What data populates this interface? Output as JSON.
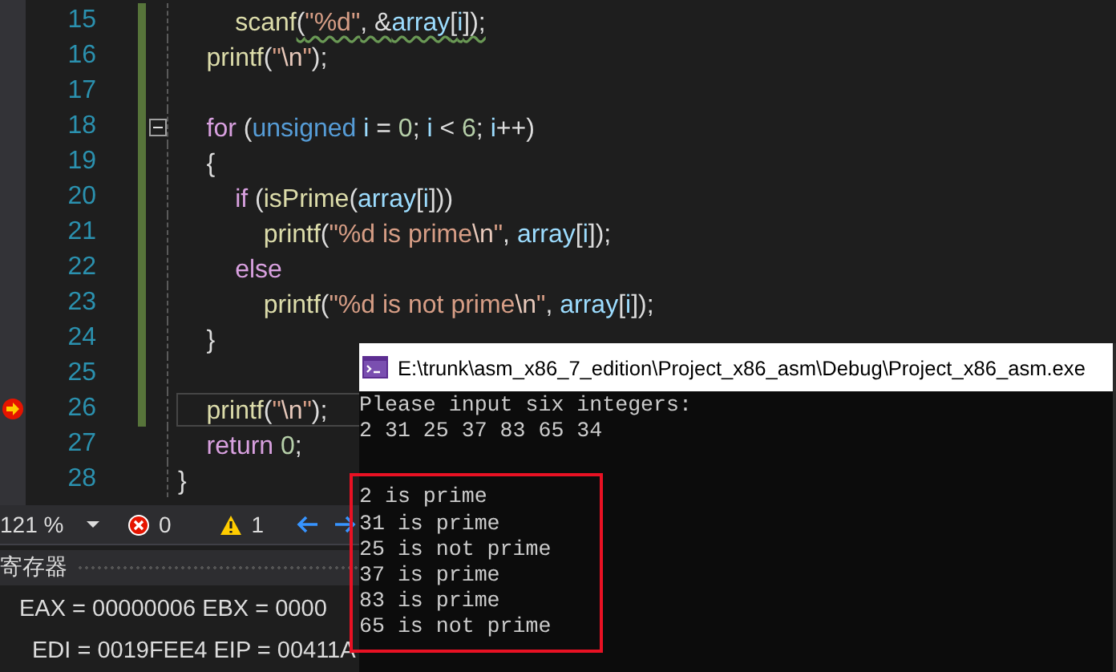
{
  "editor": {
    "lines": [
      {
        "number": "15",
        "changed": true,
        "current": false,
        "foldable": false,
        "warning": true,
        "tokens": [
          {
            "text": "        scanf",
            "kind": "func"
          },
          {
            "text": "(",
            "kind": "plain"
          },
          {
            "text": "\"%d\"",
            "kind": "string"
          },
          {
            "text": ", &",
            "kind": "plain"
          },
          {
            "text": "array",
            "kind": "var"
          },
          {
            "text": "[",
            "kind": "plain"
          },
          {
            "text": "i",
            "kind": "var"
          },
          {
            "text": "]);",
            "kind": "plain"
          }
        ]
      },
      {
        "number": "16",
        "changed": true,
        "current": false,
        "foldable": false,
        "warning": false,
        "tokens": [
          {
            "text": "    printf",
            "kind": "func"
          },
          {
            "text": "(",
            "kind": "plain"
          },
          {
            "text": "\"",
            "kind": "string"
          },
          {
            "text": "\\n",
            "kind": "escape"
          },
          {
            "text": "\"",
            "kind": "string"
          },
          {
            "text": ");",
            "kind": "plain"
          }
        ]
      },
      {
        "number": "17",
        "changed": true,
        "current": false,
        "foldable": false,
        "warning": false
      },
      {
        "number": "18",
        "changed": true,
        "current": false,
        "foldable": true,
        "warning": false,
        "tokens": [
          {
            "text": "    for",
            "kind": "control"
          },
          {
            "text": " (",
            "kind": "plain"
          },
          {
            "text": "unsigned",
            "kind": "keyword"
          },
          {
            "text": " i",
            "kind": "var"
          },
          {
            "text": " = ",
            "kind": "plain"
          },
          {
            "text": "0",
            "kind": "number"
          },
          {
            "text": "; ",
            "kind": "plain"
          },
          {
            "text": "i",
            "kind": "var"
          },
          {
            "text": " < ",
            "kind": "plain"
          },
          {
            "text": "6",
            "kind": "number"
          },
          {
            "text": "; ",
            "kind": "plain"
          },
          {
            "text": "i",
            "kind": "var"
          },
          {
            "text": "++)",
            "kind": "plain"
          }
        ]
      },
      {
        "number": "19",
        "changed": true,
        "current": false,
        "foldable": false,
        "warning": false,
        "tokens": [
          {
            "text": "    {",
            "kind": "plain"
          }
        ]
      },
      {
        "number": "20",
        "changed": true,
        "current": false,
        "foldable": false,
        "warning": false,
        "tokens": [
          {
            "text": "        if",
            "kind": "control"
          },
          {
            "text": " (",
            "kind": "plain"
          },
          {
            "text": "isPrime",
            "kind": "func"
          },
          {
            "text": "(",
            "kind": "plain"
          },
          {
            "text": "array",
            "kind": "var"
          },
          {
            "text": "[",
            "kind": "plain"
          },
          {
            "text": "i",
            "kind": "var"
          },
          {
            "text": "]))",
            "kind": "plain"
          }
        ]
      },
      {
        "number": "21",
        "changed": true,
        "current": false,
        "foldable": false,
        "warning": false,
        "tokens": [
          {
            "text": "            printf",
            "kind": "func"
          },
          {
            "text": "(",
            "kind": "plain"
          },
          {
            "text": "\"%d is prime",
            "kind": "string"
          },
          {
            "text": "\\n",
            "kind": "escape"
          },
          {
            "text": "\"",
            "kind": "string"
          },
          {
            "text": ", ",
            "kind": "plain"
          },
          {
            "text": "array",
            "kind": "var"
          },
          {
            "text": "[",
            "kind": "plain"
          },
          {
            "text": "i",
            "kind": "var"
          },
          {
            "text": "]);",
            "kind": "plain"
          }
        ]
      },
      {
        "number": "22",
        "changed": true,
        "current": false,
        "foldable": false,
        "warning": false,
        "tokens": [
          {
            "text": "        else",
            "kind": "control"
          }
        ]
      },
      {
        "number": "23",
        "changed": true,
        "current": false,
        "foldable": false,
        "warning": false,
        "tokens": [
          {
            "text": "            printf",
            "kind": "func"
          },
          {
            "text": "(",
            "kind": "plain"
          },
          {
            "text": "\"%d is not prime",
            "kind": "string"
          },
          {
            "text": "\\n",
            "kind": "escape"
          },
          {
            "text": "\"",
            "kind": "string"
          },
          {
            "text": ", ",
            "kind": "plain"
          },
          {
            "text": "array",
            "kind": "var"
          },
          {
            "text": "[",
            "kind": "plain"
          },
          {
            "text": "i",
            "kind": "var"
          },
          {
            "text": "]);",
            "kind": "plain"
          }
        ]
      },
      {
        "number": "24",
        "changed": true,
        "current": false,
        "foldable": false,
        "warning": false,
        "tokens": [
          {
            "text": "    }",
            "kind": "plain"
          }
        ]
      },
      {
        "number": "25",
        "changed": true,
        "current": false,
        "foldable": false,
        "warning": false
      },
      {
        "number": "26",
        "changed": true,
        "current": true,
        "foldable": false,
        "warning": false,
        "tokens": [
          {
            "text": "    printf",
            "kind": "func"
          },
          {
            "text": "(",
            "kind": "plain"
          },
          {
            "text": "\"",
            "kind": "string"
          },
          {
            "text": "\\n",
            "kind": "escape"
          },
          {
            "text": "\"",
            "kind": "string"
          },
          {
            "text": ");",
            "kind": "plain"
          }
        ]
      },
      {
        "number": "27",
        "changed": false,
        "current": false,
        "foldable": false,
        "warning": false,
        "tokens": [
          {
            "text": "    return",
            "kind": "control"
          },
          {
            "text": " 0",
            "kind": "number"
          },
          {
            "text": ";",
            "kind": "plain"
          }
        ]
      },
      {
        "number": "28",
        "changed": false,
        "current": false,
        "foldable": false,
        "warning": false,
        "tokens": [
          {
            "text": "}",
            "kind": "plain"
          }
        ]
      }
    ]
  },
  "status_bar": {
    "zoom": "121 %",
    "errors": "0",
    "warnings": "1"
  },
  "registers": {
    "title": "寄存器",
    "lines": [
      "EAX = 00000006 EBX = 0000",
      "EDI = 0019FEE4 EIP = 00411A"
    ]
  },
  "console": {
    "title": "E:\\trunk\\asm_x86_7_edition\\Project_x86_asm\\Debug\\Project_x86_asm.exe",
    "lines": [
      {
        "text": "Please input six integers:",
        "marked": false
      },
      {
        "text": "2 31 25 37 83 65 34",
        "marked": false
      },
      {
        "text": "2 is prime",
        "marked": true
      },
      {
        "text": "31 is prime",
        "marked": true
      },
      {
        "text": "25 is not prime",
        "marked": true
      },
      {
        "text": "37 is prime",
        "marked": true
      },
      {
        "text": "83 is prime",
        "marked": true
      },
      {
        "text": "65 is not prime",
        "marked": true
      }
    ]
  }
}
